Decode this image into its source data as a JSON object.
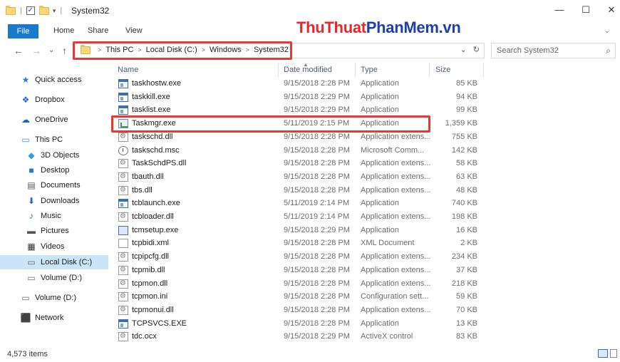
{
  "window": {
    "title": "System32",
    "minimize_glyph": "—",
    "maximize_glyph": "☐",
    "close_glyph": "✕"
  },
  "watermark": {
    "part_a": "ThuThuat",
    "part_b": "PhanMem",
    "part_c": ".vn"
  },
  "ribbon": {
    "tabs": [
      {
        "label": "File",
        "active": true
      },
      {
        "label": "Home"
      },
      {
        "label": "Share"
      },
      {
        "label": "View"
      }
    ]
  },
  "nav": {
    "back_glyph": "←",
    "forward_glyph": "→",
    "recent_glyph": "⌄",
    "up_glyph": "↑",
    "breadcrumbs": [
      "This PC",
      "Local Disk (C:)",
      "Windows",
      "System32"
    ],
    "dropdown_glyph": "⌄",
    "refresh_glyph": "↻",
    "search_placeholder": "Search System32",
    "search_glyph": "⌕"
  },
  "sidebar": {
    "items": [
      {
        "label": "Quick access",
        "icon": "star-icon"
      },
      {
        "label": "Dropbox",
        "icon": "dropbox-icon"
      },
      {
        "label": "OneDrive",
        "icon": "cloud-icon"
      },
      {
        "label": "This PC",
        "icon": "computer-icon"
      },
      {
        "label": "3D Objects",
        "icon": "cube-icon"
      },
      {
        "label": "Desktop",
        "icon": "desktop-icon"
      },
      {
        "label": "Documents",
        "icon": "documents-icon"
      },
      {
        "label": "Downloads",
        "icon": "download-icon"
      },
      {
        "label": "Music",
        "icon": "music-icon"
      },
      {
        "label": "Pictures",
        "icon": "pictures-icon"
      },
      {
        "label": "Videos",
        "icon": "videos-icon"
      },
      {
        "label": "Local Disk (C:)",
        "icon": "drive-icon",
        "selected": true
      },
      {
        "label": "Volume (D:)",
        "icon": "drive-icon"
      },
      {
        "label": "Volume (D:)",
        "icon": "drive-icon"
      },
      {
        "label": "Network",
        "icon": "network-icon"
      }
    ]
  },
  "columns": {
    "name": "Name",
    "date": "Date modified",
    "type": "Type",
    "size": "Size"
  },
  "files": [
    {
      "name": "taskhostw.exe",
      "date": "9/15/2018 2:28 PM",
      "type": "Application",
      "size": "85 KB",
      "icon": "exe"
    },
    {
      "name": "taskkill.exe",
      "date": "9/15/2018 2:29 PM",
      "type": "Application",
      "size": "94 KB",
      "icon": "exe"
    },
    {
      "name": "tasklist.exe",
      "date": "9/15/2018 2:29 PM",
      "type": "Application",
      "size": "99 KB",
      "icon": "exe"
    },
    {
      "name": "Taskmgr.exe",
      "date": "5/11/2019 2:15 PM",
      "type": "Application",
      "size": "1,359 KB",
      "icon": "task"
    },
    {
      "name": "taskschd.dll",
      "date": "9/15/2018 2:28 PM",
      "type": "Application extens...",
      "size": "755 KB",
      "icon": "dll"
    },
    {
      "name": "taskschd.msc",
      "date": "9/15/2018 2:28 PM",
      "type": "Microsoft Comm...",
      "size": "142 KB",
      "icon": "msc"
    },
    {
      "name": "TaskSchdPS.dll",
      "date": "9/15/2018 2:28 PM",
      "type": "Application extens...",
      "size": "58 KB",
      "icon": "dll"
    },
    {
      "name": "tbauth.dll",
      "date": "9/15/2018 2:28 PM",
      "type": "Application extens...",
      "size": "63 KB",
      "icon": "dll"
    },
    {
      "name": "tbs.dll",
      "date": "9/15/2018 2:28 PM",
      "type": "Application extens...",
      "size": "48 KB",
      "icon": "dll"
    },
    {
      "name": "tcblaunch.exe",
      "date": "5/11/2019 2:14 PM",
      "type": "Application",
      "size": "740 KB",
      "icon": "exe"
    },
    {
      "name": "tcbloader.dll",
      "date": "5/11/2019 2:14 PM",
      "type": "Application extens...",
      "size": "198 KB",
      "icon": "dll"
    },
    {
      "name": "tcmsetup.exe",
      "date": "9/15/2018 2:29 PM",
      "type": "Application",
      "size": "16 KB",
      "icon": "set"
    },
    {
      "name": "tcpbidi.xml",
      "date": "9/15/2018 2:28 PM",
      "type": "XML Document",
      "size": "2 KB",
      "icon": "doc"
    },
    {
      "name": "tcpipcfg.dll",
      "date": "9/15/2018 2:28 PM",
      "type": "Application extens...",
      "size": "234 KB",
      "icon": "dll"
    },
    {
      "name": "tcpmib.dll",
      "date": "9/15/2018 2:28 PM",
      "type": "Application extens...",
      "size": "37 KB",
      "icon": "dll"
    },
    {
      "name": "tcpmon.dll",
      "date": "9/15/2018 2:28 PM",
      "type": "Application extens...",
      "size": "218 KB",
      "icon": "dll"
    },
    {
      "name": "tcpmon.ini",
      "date": "9/15/2018 2:28 PM",
      "type": "Configuration sett...",
      "size": "59 KB",
      "icon": "dll"
    },
    {
      "name": "tcpmonui.dll",
      "date": "9/15/2018 2:28 PM",
      "type": "Application extens...",
      "size": "70 KB",
      "icon": "dll"
    },
    {
      "name": "TCPSVCS.EXE",
      "date": "9/15/2018 2:28 PM",
      "type": "Application",
      "size": "13 KB",
      "icon": "exe"
    },
    {
      "name": "tdc.ocx",
      "date": "9/15/2018 2:29 PM",
      "type": "ActiveX control",
      "size": "83 KB",
      "icon": "dll"
    }
  ],
  "status": {
    "item_count": "4,573 items"
  },
  "colors": {
    "accent": "#1979ca",
    "highlight": "#e53935",
    "selected_bg": "#cce4f7"
  }
}
